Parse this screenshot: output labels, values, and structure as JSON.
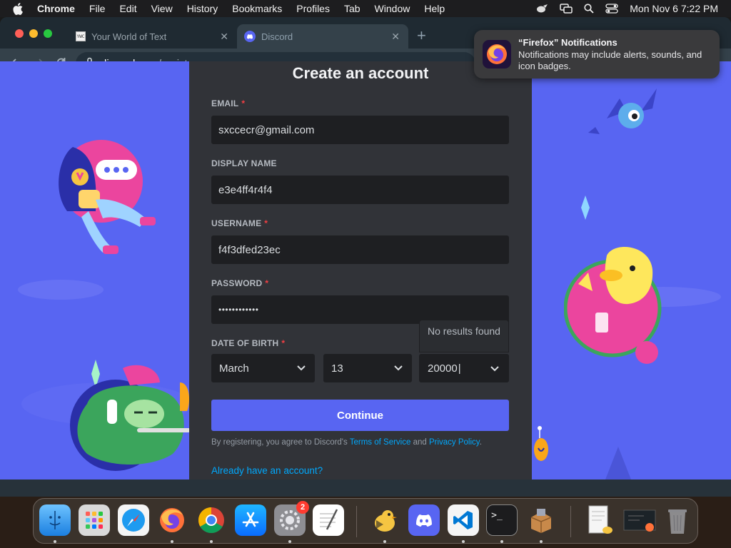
{
  "menubar": {
    "app_name": "Chrome",
    "menus": [
      "File",
      "Edit",
      "View",
      "History",
      "Bookmarks",
      "Profiles",
      "Tab",
      "Window",
      "Help"
    ],
    "clock": "Mon Nov 6  7:22 PM"
  },
  "tabs": [
    {
      "title": "Your World of Text",
      "favicon_text": "YWC",
      "active": false
    },
    {
      "title": "Discord",
      "active": true
    }
  ],
  "toolbar": {
    "url_host": "discord.com",
    "url_path": "/register"
  },
  "form": {
    "title": "Create an account",
    "email": {
      "label": "EMAIL",
      "value": "sxccecr@gmail.com",
      "required": true
    },
    "display_name": {
      "label": "DISPLAY NAME",
      "value": "e3e4ff4r4f4",
      "required": false
    },
    "username": {
      "label": "USERNAME",
      "value": "f4f3dfed23ec",
      "required": true
    },
    "password": {
      "label": "PASSWORD",
      "value": "••••••••••••",
      "required": true
    },
    "dob": {
      "label": "DATE OF BIRTH",
      "required": true,
      "month": "March",
      "day": "13",
      "year": "20000",
      "year_dropdown_hint": "No results found"
    },
    "required_marker": "*",
    "continue_label": "Continue",
    "terms": {
      "prefix": "By registering, you agree to Discord's ",
      "tos_link": "Terms of Service",
      "and": " and ",
      "privacy_link": "Privacy Policy",
      "suffix": "."
    },
    "login_link": "Already have an account?"
  },
  "notification": {
    "title": "“Firefox” Notifications",
    "body": "Notifications may include alerts, sounds, and icon badges."
  },
  "dock": {
    "items": [
      "finder-icon",
      "launchpad-icon",
      "safari-icon",
      "firefox-icon",
      "chrome-icon",
      "app-store-icon",
      "system-settings-icon",
      "textedit-icon",
      "cyberduck-icon",
      "discord-icon",
      "vscode-icon",
      "terminal-icon",
      "archive-utility-icon",
      "document-preview-icon",
      "screen-preview-icon",
      "trash-icon"
    ],
    "settings_badge": "2"
  },
  "colors": {
    "discord_blurple": "#5865f2",
    "card_bg": "#313338",
    "input_bg": "#1e1f22",
    "link": "#00a8fc",
    "required": "#f23f43"
  }
}
